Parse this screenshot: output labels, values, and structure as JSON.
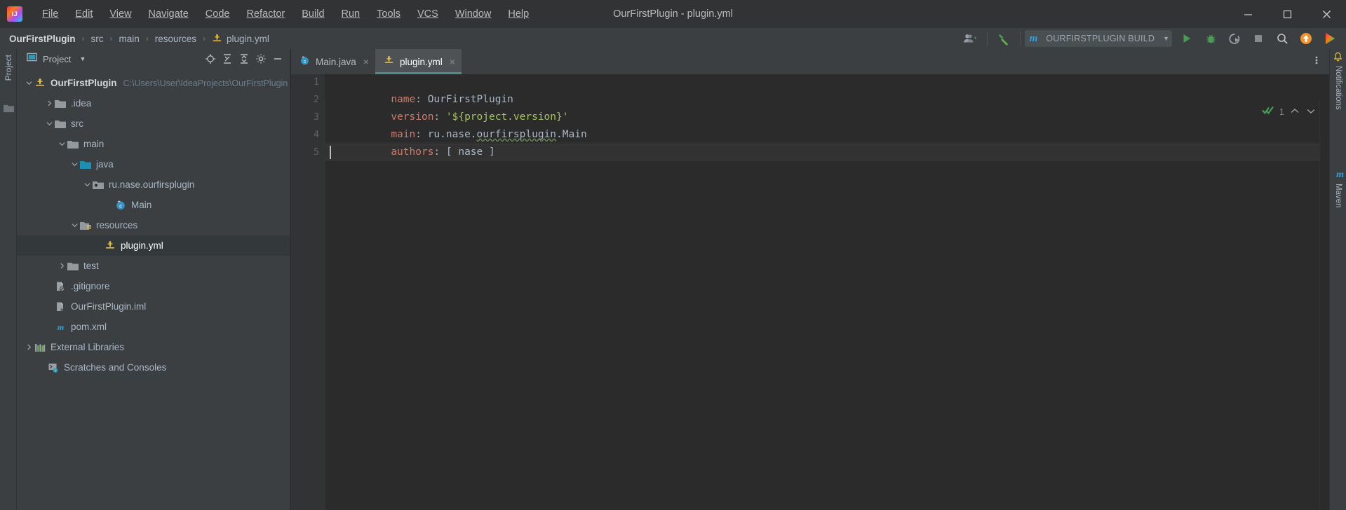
{
  "window": {
    "title": "OurFirstPlugin - plugin.yml",
    "controls": [
      {
        "name": "minimize",
        "glyph": "minimize-icon"
      },
      {
        "name": "maximize",
        "glyph": "maximize-icon"
      },
      {
        "name": "close",
        "glyph": "close-icon"
      }
    ]
  },
  "menu": {
    "logo": "intellij-idea-logo",
    "items": [
      {
        "label": "File",
        "mnemonic": "F"
      },
      {
        "label": "Edit",
        "mnemonic": "E"
      },
      {
        "label": "View",
        "mnemonic": "V"
      },
      {
        "label": "Navigate",
        "mnemonic": "N"
      },
      {
        "label": "Code",
        "mnemonic": "C"
      },
      {
        "label": "Refactor",
        "mnemonic": "R"
      },
      {
        "label": "Build",
        "mnemonic": "B"
      },
      {
        "label": "Run",
        "mnemonic": "u"
      },
      {
        "label": "Tools",
        "mnemonic": "T"
      },
      {
        "label": "VCS",
        "mnemonic": "S"
      },
      {
        "label": "Window",
        "mnemonic": "W"
      },
      {
        "label": "Help",
        "mnemonic": "H"
      }
    ]
  },
  "navbar": {
    "crumbs": [
      {
        "label": "OurFirstPlugin",
        "bold": true,
        "icon": ""
      },
      {
        "label": "src",
        "bold": false,
        "icon": ""
      },
      {
        "label": "main",
        "bold": false,
        "icon": ""
      },
      {
        "label": "resources",
        "bold": false,
        "icon": ""
      },
      {
        "label": "plugin.yml",
        "bold": false,
        "icon": "spigot-yaml-icon"
      }
    ],
    "separator": "›",
    "vcs_user_icon": "user-dropdown-icon",
    "hammer_icon": "build-hammer-icon",
    "run_config": {
      "maven_letter": "m",
      "name": "OURFIRSTPLUGIN BUILD",
      "caret": "▼"
    },
    "right_icons": [
      {
        "name": "run-button",
        "glyph": "play-icon"
      },
      {
        "name": "debug-button",
        "glyph": "bug-icon"
      },
      {
        "name": "run-with-coverage-button",
        "glyph": "coverage-icon"
      },
      {
        "name": "stop-button",
        "glyph": "stop-icon"
      },
      {
        "name": "search-everywhere-button",
        "glyph": "search-icon"
      },
      {
        "name": "update-project-button",
        "glyph": "up-arrow-icon"
      },
      {
        "name": "ide-feature-button",
        "glyph": "colorful-play-icon"
      }
    ]
  },
  "left_strip": {
    "project_label": "Project",
    "folder_icon": "folder-icon"
  },
  "right_strip": {
    "notifications_label": "Notifications",
    "maven_label": "Maven",
    "maven_letter": "m"
  },
  "project_panel": {
    "title": "Project",
    "title_icon": "project-view-icon",
    "caret": "▾",
    "actions": [
      {
        "name": "select-opened-file-button",
        "glyph": "crosshair-icon"
      },
      {
        "name": "expand-all-button",
        "glyph": "expand-all-icon"
      },
      {
        "name": "collapse-all-button",
        "glyph": "collapse-all-icon"
      },
      {
        "name": "settings-button",
        "glyph": "gear-icon"
      },
      {
        "name": "hide-button",
        "glyph": "minus-icon"
      }
    ],
    "tree": [
      {
        "label": "OurFirstPlugin",
        "path": "C:\\Users\\User\\IdeaProjects\\OurFirstPlugin",
        "depth": 0,
        "arrow": "down",
        "icon": "spigot-project-icon",
        "bold": true,
        "selected": false
      },
      {
        "label": ".idea",
        "path": "",
        "depth": 1,
        "arrow": "right",
        "icon": "folder-icon",
        "bold": false,
        "selected": false
      },
      {
        "label": "src",
        "path": "",
        "depth": 1,
        "arrow": "down",
        "icon": "folder-icon",
        "bold": false,
        "selected": false
      },
      {
        "label": "main",
        "path": "",
        "depth": 2,
        "arrow": "down",
        "icon": "folder-icon",
        "bold": false,
        "selected": false
      },
      {
        "label": "java",
        "path": "",
        "depth": 3,
        "arrow": "down",
        "icon": "source-root-folder-icon",
        "bold": false,
        "selected": false
      },
      {
        "label": "ru.nase.ourfirsplugin",
        "path": "",
        "depth": 4,
        "arrow": "down",
        "icon": "package-icon",
        "bold": false,
        "selected": false
      },
      {
        "label": "Main",
        "path": "",
        "depth": 5,
        "arrow": "none",
        "icon": "java-class-icon",
        "bold": false,
        "selected": false
      },
      {
        "label": "resources",
        "path": "",
        "depth": 3,
        "arrow": "down",
        "icon": "resource-root-folder-icon",
        "bold": false,
        "selected": false
      },
      {
        "label": "plugin.yml",
        "path": "",
        "depth": 4,
        "arrow": "none",
        "icon": "spigot-yaml-icon",
        "bold": false,
        "selected": true
      },
      {
        "label": "test",
        "path": "",
        "depth": 2,
        "arrow": "right",
        "icon": "folder-icon",
        "bold": false,
        "selected": false
      },
      {
        "label": ".gitignore",
        "path": "",
        "depth": 1,
        "arrow": "none",
        "icon": "gitignore-file-icon",
        "bold": false,
        "selected": false
      },
      {
        "label": "OurFirstPlugin.iml",
        "path": "",
        "depth": 1,
        "arrow": "none",
        "icon": "iml-file-icon",
        "bold": false,
        "selected": false
      },
      {
        "label": "pom.xml",
        "path": "",
        "depth": 1,
        "arrow": "none",
        "icon": "maven-pom-icon",
        "bold": false,
        "selected": false
      },
      {
        "label": "External Libraries",
        "path": "",
        "depth": 0,
        "arrow": "right",
        "icon": "libraries-icon",
        "bold": false,
        "selected": false
      },
      {
        "label": "Scratches and Consoles",
        "path": "",
        "depth": 0,
        "arrow": "none",
        "icon": "scratches-icon",
        "bold": false,
        "selected": false
      }
    ]
  },
  "editor": {
    "tabs": [
      {
        "label": "Main.java",
        "icon": "java-class-icon",
        "active": false,
        "close": "×"
      },
      {
        "label": "plugin.yml",
        "icon": "spigot-yaml-icon",
        "active": true,
        "close": "×"
      }
    ],
    "options_icon": "more-options-icon",
    "line_numbers": [
      "1",
      "2",
      "3",
      "4",
      "5"
    ],
    "lines": [
      {
        "n": 1,
        "key": "name",
        "colon": ":",
        "value": " OurFirstPlugin",
        "value_type": "plain",
        "typo_from": -1,
        "typo_len": 0
      },
      {
        "n": 2,
        "key": "version",
        "colon": ":",
        "value": " '${project.version}'",
        "value_type": "string",
        "typo_from": -1,
        "typo_len": 0
      },
      {
        "n": 3,
        "key": "main",
        "colon": ":",
        "value": " ru.nase.ourfirsplugin.Main",
        "value_type": "plain",
        "typo_from": 9,
        "typo_len": 13
      },
      {
        "n": 4,
        "key": "authors",
        "colon": ":",
        "value": " [ nase ]",
        "value_type": "plain",
        "typo_from": -1,
        "typo_len": 0
      },
      {
        "n": 5,
        "key": "",
        "colon": "",
        "value": "",
        "value_type": "empty",
        "typo_from": -1,
        "typo_len": 0
      }
    ],
    "inspection": {
      "icon": "double-checkmark-icon",
      "count": "1",
      "prev_chevron": "⌃",
      "next_chevron": "⌄"
    }
  },
  "colors": {
    "titlebar_bg": "#313335",
    "toolbar_bg": "#3c3f41",
    "editor_bg": "#2b2b2b",
    "gutter_bg": "#313335",
    "tab_active_bg": "#4e5254",
    "tab_underline": "#4a8f8f",
    "key_color": "#cc7b6c",
    "string_color": "#a5c261",
    "text_color": "#a9b7c6",
    "accent_yellow": "#e8bf3f",
    "accent_blue": "#389fd6",
    "green": "#499c54"
  }
}
